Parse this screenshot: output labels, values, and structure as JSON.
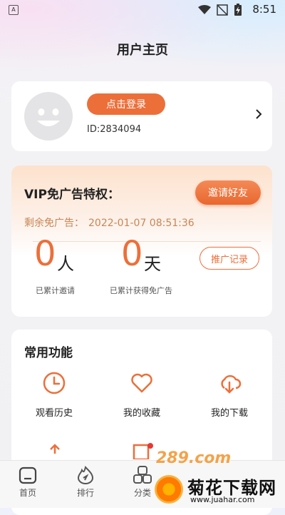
{
  "status_bar": {
    "time": "8:51",
    "indicator": "A"
  },
  "page_title": "用户主页",
  "profile": {
    "login_label": "点击登录",
    "user_id": "ID:2834094"
  },
  "vip": {
    "title": "VIP免广告特权：",
    "invite_label": "邀请好友",
    "remaining_label": "剩余免广告：",
    "remaining_value": "2022-01-07 08:51:36",
    "invited_count": "0",
    "invited_unit": "人",
    "invited_caption": "已累计邀请",
    "days_count": "0",
    "days_unit": "天",
    "days_caption": "已累计获得免广告",
    "records_label": "推广记录"
  },
  "functions": {
    "title": "常用功能",
    "items": [
      {
        "label": "观看历史",
        "icon": "clock-icon"
      },
      {
        "label": "我的收藏",
        "icon": "heart-icon"
      },
      {
        "label": "我的下载",
        "icon": "cloud-download-icon"
      }
    ]
  },
  "bottom_nav": [
    {
      "label": "首页",
      "icon": "home-icon"
    },
    {
      "label": "排行",
      "icon": "flame-icon"
    },
    {
      "label": "分类",
      "icon": "category-icon"
    }
  ],
  "watermark": {
    "logo": "289.com",
    "name": "菊花下载网",
    "url": "www.juahar.com"
  },
  "colors": {
    "accent": "#ec6f3a",
    "vip_text": "#c98655"
  }
}
